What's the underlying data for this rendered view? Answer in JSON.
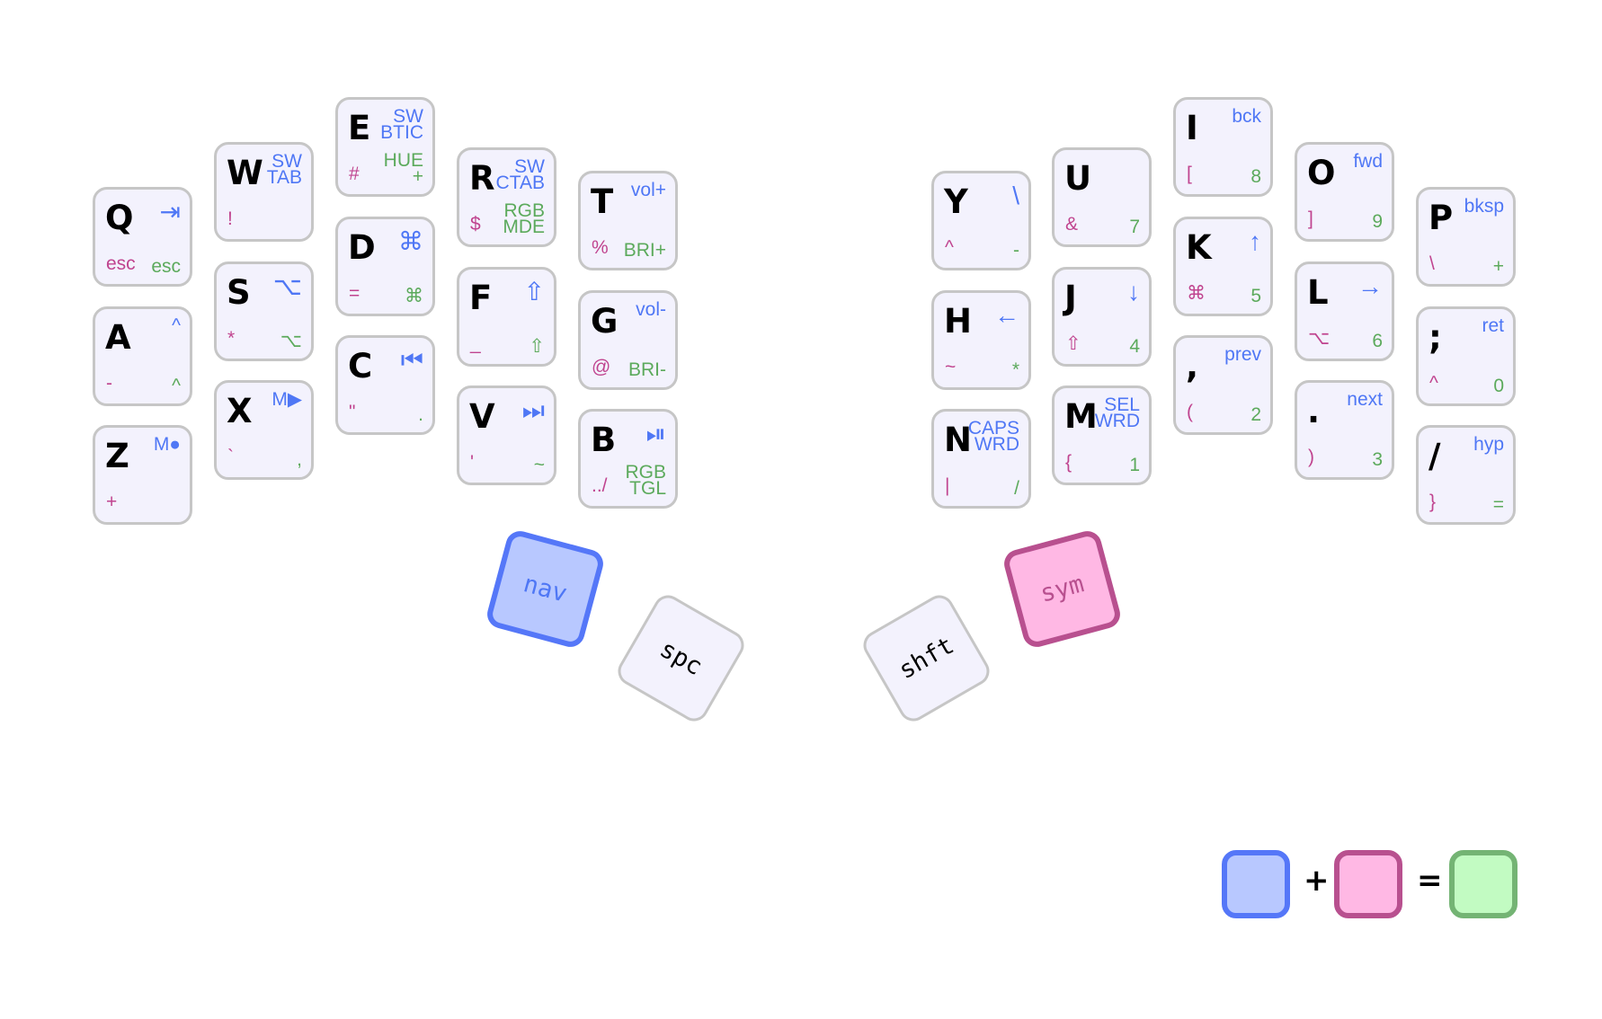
{
  "colors": {
    "nav": "#4f77f5",
    "sym": "#c0448f",
    "combo": "#5caa5c",
    "key_fill": "#f3f2fd",
    "key_border": "#c6c6c6",
    "nav_fill": "#b8c8ff",
    "sym_fill": "#ffb8e4",
    "combo_fill": "#c2fbc2",
    "combo_border": "#74b474"
  },
  "keys": [
    {
      "main": "Q",
      "tr": "⇥",
      "bl": "esc",
      "br": "esc"
    },
    {
      "main": "A",
      "tr": "^",
      "bl": "-",
      "br": "^"
    },
    {
      "main": "Z",
      "tr": "M●",
      "bl": "+",
      "br": ""
    },
    {
      "main": "W",
      "tr": "SW\nTAB",
      "bl": "!",
      "br": ""
    },
    {
      "main": "S",
      "tr": "⌥",
      "bl": "*",
      "br": "⌥"
    },
    {
      "main": "X",
      "tr": "M▶",
      "bl": "`",
      "br": ","
    },
    {
      "main": "E",
      "tr": "SW\nBTIC",
      "bl": "#",
      "br": "HUE\n+"
    },
    {
      "main": "D",
      "tr": "⌘",
      "bl": "=",
      "br": "⌘"
    },
    {
      "main": "C",
      "tr": "⏮",
      "bl": "\"",
      "br": "."
    },
    {
      "main": "R",
      "tr": "SW\nCTAB",
      "bl": "$",
      "br": "RGB\nMDE"
    },
    {
      "main": "F",
      "tr": "⇧",
      "bl": "_",
      "br": "⇧"
    },
    {
      "main": "V",
      "tr": "⏭",
      "bl": "'",
      "br": "~"
    },
    {
      "main": "T",
      "tr": "vol+",
      "bl": "%",
      "br": "BRI+"
    },
    {
      "main": "G",
      "tr": "vol-",
      "bl": "@",
      "br": "BRI-"
    },
    {
      "main": "B",
      "tr": "⏯",
      "bl": "../",
      "br": "RGB\nTGL"
    },
    {
      "main": "Y",
      "tr": "\\",
      "bl": "^",
      "br": "-"
    },
    {
      "main": "H",
      "tr": "←",
      "bl": "~",
      "br": "*"
    },
    {
      "main": "N",
      "tr": "CAPS\nWRD",
      "bl": "|",
      "br": "/"
    },
    {
      "main": "U",
      "tr": "",
      "bl": "&",
      "br": "7"
    },
    {
      "main": "J",
      "tr": "↓",
      "bl": "⇧",
      "br": "4"
    },
    {
      "main": "M",
      "tr": "SEL\nWRD",
      "bl": "{",
      "br": "1"
    },
    {
      "main": "I",
      "tr": "bck",
      "bl": "[",
      "br": "8"
    },
    {
      "main": "K",
      "tr": "↑",
      "bl": "⌘",
      "br": "5"
    },
    {
      "main": ",",
      "tr": "prev",
      "bl": "(",
      "br": "2"
    },
    {
      "main": "O",
      "tr": "fwd",
      "bl": "]",
      "br": "9"
    },
    {
      "main": "L",
      "tr": "→",
      "bl": "⌥",
      "br": "6"
    },
    {
      "main": ".",
      "tr": "next",
      "bl": ")",
      "br": "3"
    },
    {
      "main": "P",
      "tr": "bksp",
      "bl": "\\",
      "br": "+"
    },
    {
      "main": ";",
      "tr": "ret",
      "bl": "^",
      "br": "0"
    },
    {
      "main": "/",
      "tr": "hyp",
      "bl": "}",
      "br": "="
    }
  ],
  "thumbs": [
    {
      "label": "nav",
      "layer": "nav"
    },
    {
      "label": "spc",
      "layer": "base"
    },
    {
      "label": "shft",
      "layer": "base"
    },
    {
      "label": "sym",
      "layer": "sym"
    }
  ],
  "legend": {
    "plus": "+",
    "equals": "="
  }
}
